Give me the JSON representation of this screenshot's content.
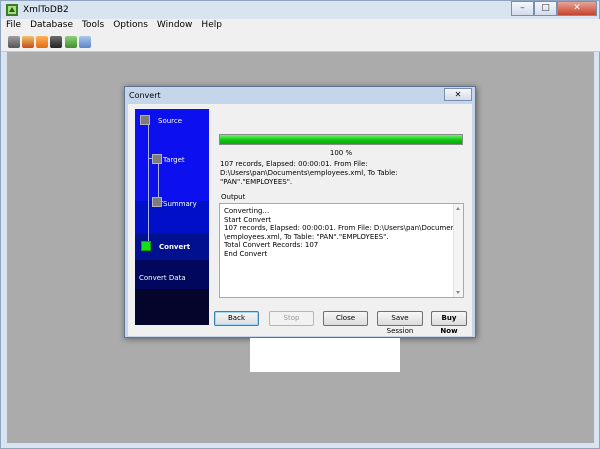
{
  "app": {
    "title": "XmlToDB2",
    "window_buttons": {
      "minimize": "–",
      "maximize": "□",
      "close": "✕"
    }
  },
  "menu": [
    "File",
    "Database",
    "Tools",
    "Options",
    "Window",
    "Help"
  ],
  "toolbar_icons": [
    "home-icon",
    "wizard-icon",
    "table-icon",
    "script-icon",
    "export-icon",
    "grid-icon"
  ],
  "dialog": {
    "title": "Convert",
    "close": "✕",
    "steps": [
      {
        "label": "Source",
        "active": false
      },
      {
        "label": "Target",
        "active": false
      },
      {
        "label": "Summary",
        "active": false
      },
      {
        "label": "Convert",
        "active": true
      }
    ],
    "sidebar_caption": "Convert Data",
    "progress": {
      "value": 1.0,
      "text": "100 %"
    },
    "info": {
      "line1": "107 records,    Elapsed: 00:00:01.    From File:",
      "line2": "D:\\Users\\pan\\Documents\\employees.xml,     To Table: \"PAN\".\"EMPLOYEES\"."
    },
    "output_label": "Output",
    "output_lines": [
      "Converting...",
      "Start Convert",
      "107 records,    Elapsed: 00:00:01.    From File: D:\\Users\\pan\\Documents",
      "\\employees.xml,     To Table: \"PAN\".\"EMPLOYEES\".",
      "Total Convert Records: 107",
      "End Convert"
    ],
    "buttons": {
      "back": "Back",
      "stop": "Stop",
      "close": "Close",
      "save_session": "Save Session",
      "buy_now": "Buy Now"
    }
  },
  "colors": {
    "progress": "#11c611",
    "sidebar_top": "#0c10ee",
    "active_step": "#18e018"
  }
}
